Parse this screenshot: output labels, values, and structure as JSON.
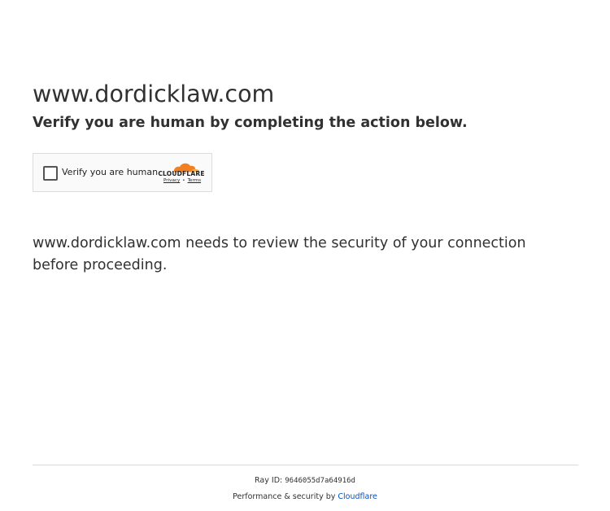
{
  "header": {
    "domain": "www.dordicklaw.com",
    "subtitle": "Verify you are human by completing the action below."
  },
  "widget": {
    "checkbox_label": "Verify you are human",
    "brand": "CLOUDFLARE",
    "privacy_link": "Privacy",
    "separator": "•",
    "terms_link": "Terms",
    "colors": {
      "cloud_orange": "#f38020",
      "cloud_light": "#faae40"
    }
  },
  "body": {
    "review_text": "www.dordicklaw.com needs to review the security of your connection before proceeding."
  },
  "footer": {
    "ray_label": "Ray ID:",
    "ray_id": "9646055d7a64916d",
    "perf_text": "Performance & security by",
    "cloudflare_link": "Cloudflare",
    "link_color": "#0051c3"
  }
}
